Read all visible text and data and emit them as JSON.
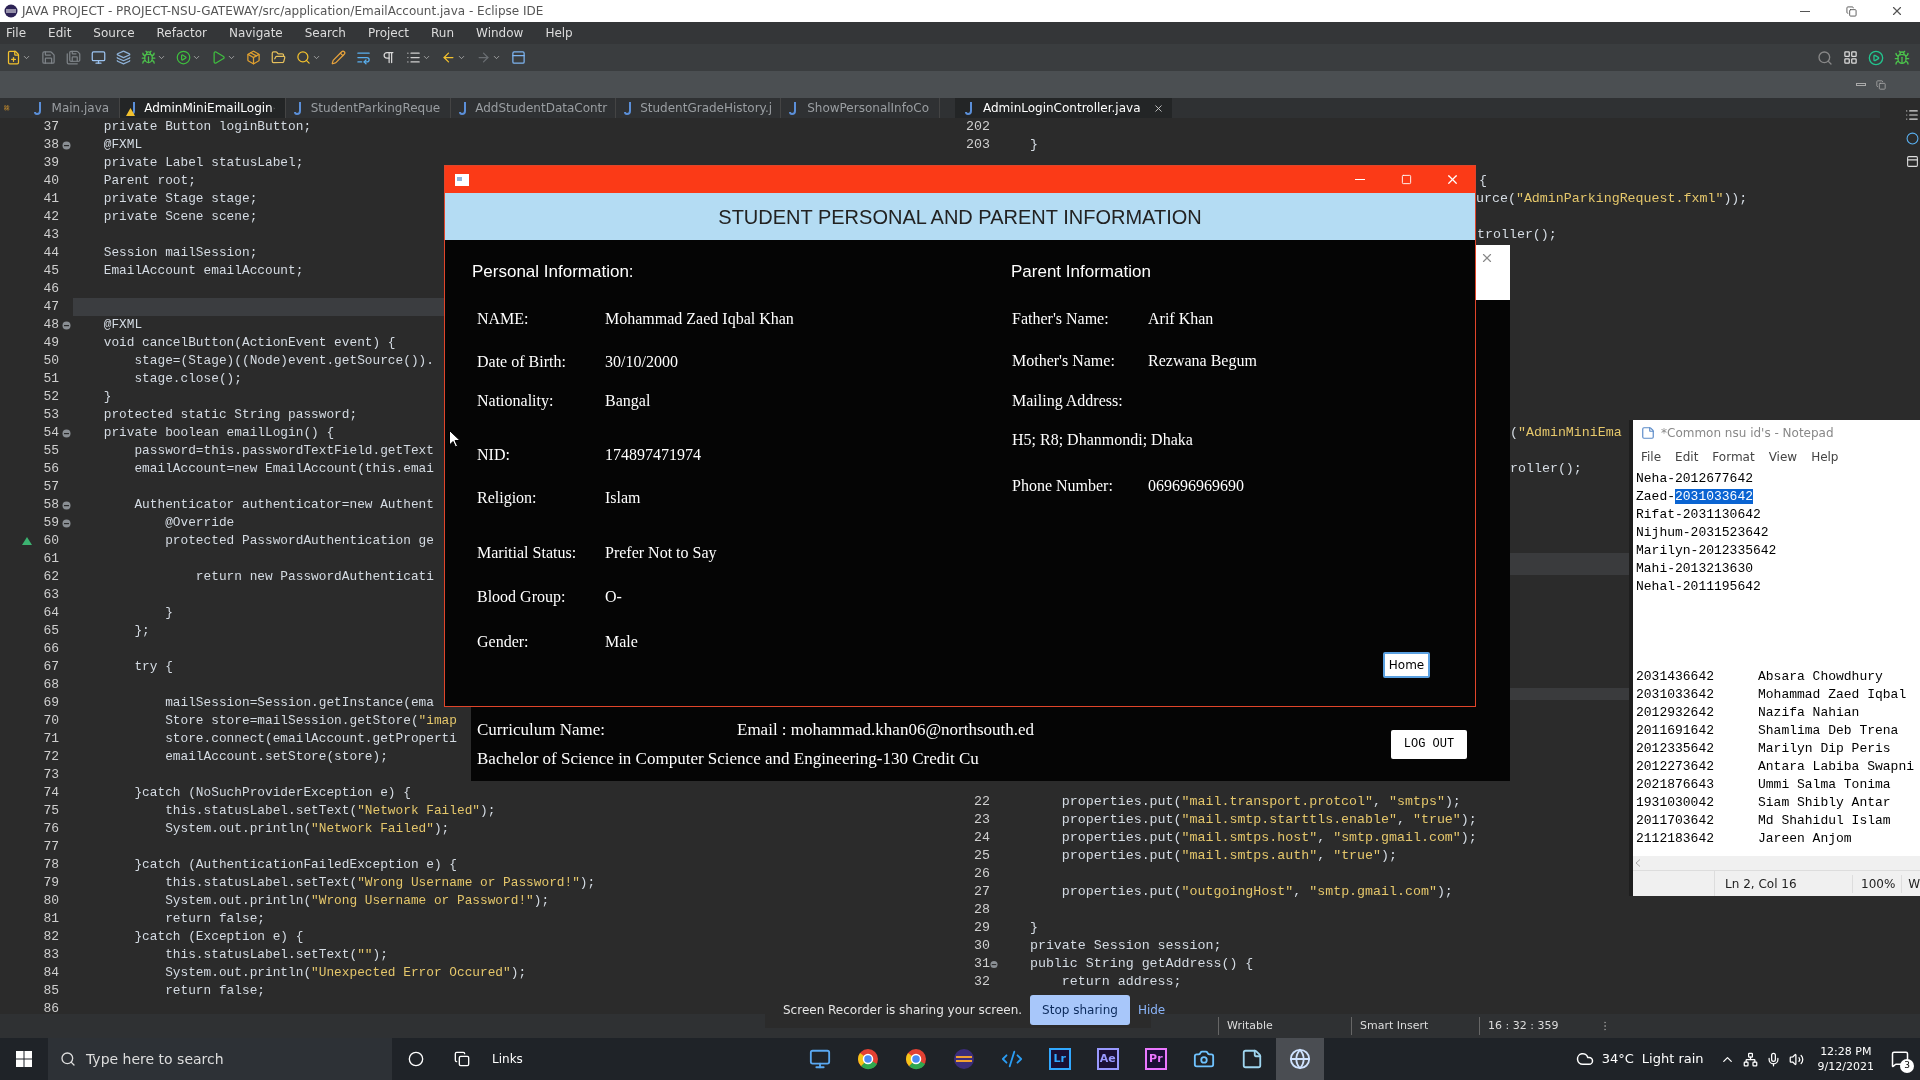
{
  "window": {
    "title": "JAVA PROJECT - PROJECT-NSU-GATEWAY/src/application/EmailAccount.java - Eclipse IDE"
  },
  "menu": [
    "File",
    "Edit",
    "Source",
    "Refactor",
    "Navigate",
    "Search",
    "Project",
    "Run",
    "Window",
    "Help"
  ],
  "left_tabs": [
    {
      "label": "Main.java",
      "selected": false,
      "warning": false
    },
    {
      "label": "AdminMiniEmailLogin",
      "selected": true,
      "warning": true
    },
    {
      "label": "StudentParkingReque",
      "selected": false,
      "warning": false
    },
    {
      "label": "AddStudentDataContr",
      "selected": false,
      "warning": false
    },
    {
      "label": "StudentGradeHistory.j",
      "selected": false,
      "warning": false
    },
    {
      "label": "ShowPersonalInfoCo",
      "selected": false,
      "warning": false
    }
  ],
  "left_editor": {
    "lines": [
      {
        "number": "37",
        "code": "    private Button loginButton;",
        "fold": false,
        "current": false,
        "override": false
      },
      {
        "number": "38",
        "code": "    @FXML",
        "fold": true,
        "current": false,
        "override": false
      },
      {
        "number": "39",
        "code": "    private Label statusLabel;",
        "fold": false,
        "current": false,
        "override": false
      },
      {
        "number": "40",
        "code": "    Parent root;",
        "fold": false,
        "current": false,
        "override": false
      },
      {
        "number": "41",
        "code": "    private Stage stage;",
        "fold": false,
        "current": false,
        "override": false
      },
      {
        "number": "42",
        "code": "    private Scene scene;",
        "fold": false,
        "current": false,
        "override": false
      },
      {
        "number": "43",
        "fold": false,
        "current": false,
        "override": false
      },
      {
        "number": "44",
        "code": "    Session mailSession;",
        "fold": false,
        "current": false,
        "override": false
      },
      {
        "number": "45",
        "code": "    EmailAccount emailAccount;",
        "fold": false,
        "current": false,
        "override": false
      },
      {
        "number": "46",
        "fold": false,
        "current": false,
        "override": false
      },
      {
        "number": "47",
        "fold": false,
        "current": true,
        "override": false
      },
      {
        "number": "48",
        "code": "    @FXML",
        "fold": true,
        "current": false,
        "override": false
      },
      {
        "number": "49",
        "code": "    void cancelButton(ActionEvent event) {",
        "fold": false,
        "current": false,
        "override": false
      },
      {
        "number": "50",
        "code": "        stage=(Stage)((Node)event.getSource()).",
        "fold": false,
        "current": false,
        "override": false
      },
      {
        "number": "51",
        "code": "        stage.close();",
        "fold": false,
        "current": false,
        "override": false
      },
      {
        "number": "52",
        "code": "    }",
        "fold": false,
        "current": false,
        "override": false
      },
      {
        "number": "53",
        "code": "    protected static String password;",
        "fold": false,
        "current": false,
        "override": false
      },
      {
        "number": "54",
        "code": "    private boolean emailLogin() {",
        "fold": true,
        "current": false,
        "override": false
      },
      {
        "number": "55",
        "code": "        password=this.passwordTextField.getText",
        "fold": false,
        "current": false,
        "override": false
      },
      {
        "number": "56",
        "code": "        emailAccount=new EmailAccount(this.emai",
        "fold": false,
        "current": false,
        "override": false
      },
      {
        "number": "57",
        "fold": false,
        "current": false,
        "override": false
      },
      {
        "number": "58",
        "code": "        Authenticator authenticator=new Authent",
        "fold": true,
        "current": false,
        "override": false
      },
      {
        "number": "59",
        "code": "            @Override",
        "fold": true,
        "current": false,
        "override": false
      },
      {
        "number": "60",
        "code": "            protected PasswordAuthentication ge",
        "fold": false,
        "current": false,
        "override": true
      },
      {
        "number": "61",
        "fold": false,
        "current": false,
        "override": false
      },
      {
        "number": "62",
        "code": "                return new PasswordAuthenticati",
        "fold": false,
        "current": false,
        "override": false
      },
      {
        "number": "63",
        "fold": false,
        "current": false,
        "override": false
      },
      {
        "number": "64",
        "code": "            }",
        "fold": false,
        "current": false,
        "override": false
      },
      {
        "number": "65",
        "code": "        };",
        "fold": false,
        "current": false,
        "override": false
      },
      {
        "number": "66",
        "fold": false,
        "current": false,
        "override": false
      },
      {
        "number": "67",
        "code": "        try {",
        "fold": false,
        "current": false,
        "override": false
      },
      {
        "number": "68",
        "fold": false,
        "current": false,
        "override": false
      },
      {
        "number": "69",
        "code": "            mailSession=Session.getInstance(ema",
        "fold": false,
        "current": false,
        "override": false
      },
      {
        "number": "70",
        "code": "            Store store=mailSession.getStore(\"imap",
        "fold": false,
        "current": false,
        "override": false
      },
      {
        "number": "71",
        "code": "            store.connect(emailAccount.getProperti",
        "fold": false,
        "current": false,
        "override": false
      },
      {
        "number": "72",
        "code": "            emailAccount.setStore(store);",
        "fold": false,
        "current": false,
        "override": false
      },
      {
        "number": "73",
        "fold": false,
        "current": false,
        "override": false
      },
      {
        "number": "74",
        "code": "        }catch (NoSuchProviderException e) {",
        "fold": false,
        "current": false,
        "override": false
      },
      {
        "number": "75",
        "code": "            this.statusLabel.setText(\"Network Failed\");",
        "fold": false,
        "current": false,
        "override": false
      },
      {
        "number": "76",
        "code": "            System.out.println(\"Network Failed\");",
        "fold": false,
        "current": false,
        "override": false
      },
      {
        "number": "77",
        "fold": false,
        "current": false,
        "override": false
      },
      {
        "number": "78",
        "code": "        }catch (AuthenticationFailedException e) {",
        "fold": false,
        "current": false,
        "override": false
      },
      {
        "number": "79",
        "code": "            this.statusLabel.setText(\"Wrong Username or Password!\");",
        "fold": false,
        "current": false,
        "override": false
      },
      {
        "number": "80",
        "code": "            System.out.println(\"Wrong Username or Password!\");",
        "fold": false,
        "current": false,
        "override": false
      },
      {
        "number": "81",
        "code": "            return false;",
        "fold": false,
        "current": false,
        "override": false
      },
      {
        "number": "82",
        "code": "        }catch (Exception e) {",
        "fold": false,
        "current": false,
        "override": false
      },
      {
        "number": "83",
        "code": "            this.statusLabel.setText(\"\");",
        "fold": false,
        "current": false,
        "override": false
      },
      {
        "number": "84",
        "code": "            System.out.println(\"Unexpected Error Occured\");",
        "fold": false,
        "current": false,
        "override": false
      },
      {
        "number": "85",
        "code": "            return false;",
        "fold": false,
        "current": false,
        "override": false
      },
      {
        "number": "86",
        "fold": false,
        "current": false,
        "override": false
      }
    ]
  },
  "right_editor": {
    "tabs": [
      {
        "label": "AdminLoginController.java",
        "selected": true
      }
    ],
    "top_lines": [
      {
        "kind": "line",
        "number": "202"
      },
      {
        "kind": "line",
        "number": "203",
        "code": "    }"
      },
      {
        "kind": "fragment",
        "code": "{"
      },
      {
        "kind": "fragment",
        "code": "urce(\"AdminParkingRequest.fxml\"));"
      },
      {
        "kind": "fragment",
        "code": "troller();"
      },
      {
        "kind": "fragment",
        "code": "(\"AdminMiniEma"
      },
      {
        "kind": "fragment",
        "code": "roller();"
      }
    ],
    "lower_lines": [
      {
        "number": "22",
        "code": "        properties.put(\"mail.transport.protcol\", \"smtps\");",
        "fold": false
      },
      {
        "number": "23",
        "code": "        properties.put(\"mail.smtp.starttls.enable\", \"true\");",
        "fold": false
      },
      {
        "number": "24",
        "code": "        properties.put(\"mail.smtps.host\", \"smtp.gmail.com\");",
        "fold": false
      },
      {
        "number": "25",
        "code": "        properties.put(\"mail.smtps.auth\", \"true\");",
        "fold": false
      },
      {
        "number": "26",
        "fold": false
      },
      {
        "number": "27",
        "code": "        properties.put(\"outgoingHost\", \"smtp.gmail.com\");",
        "fold": false
      },
      {
        "number": "28",
        "fold": false
      },
      {
        "number": "29",
        "code": "    }",
        "fold": false
      },
      {
        "number": "30",
        "code": "    private Session session;",
        "fold": false
      },
      {
        "number": "31",
        "code": "    public String getAddress() {",
        "fold": true
      },
      {
        "number": "32",
        "code": "        return address;",
        "fold": false
      }
    ]
  },
  "back_window": {
    "curriculum_label": "Curriculum Name:",
    "email": "Email : mohammad.khan06@northsouth.ed",
    "curriculum": "Bachelor of Science in Computer Science and Engineering-130 Credit Cu",
    "logout": "LOG OUT"
  },
  "dialog": {
    "heading": "STUDENT PERSONAL AND PARENT INFORMATION",
    "personal": {
      "title": "Personal Information:",
      "fields": [
        {
          "label": "NAME:",
          "value": "Mohammad Zaed Iqbal Khan"
        },
        {
          "label": "Date of Birth:",
          "value": "30/10/2000"
        },
        {
          "label": "Nationality:",
          "value": "Bangal"
        },
        {
          "label": "NID:",
          "value": "174897471974"
        },
        {
          "label": "Religion:",
          "value": "Islam"
        },
        {
          "label": "Maritial Status:",
          "value": "Prefer Not to Say"
        },
        {
          "label": "Blood Group:",
          "value": "O-"
        },
        {
          "label": "Gender:",
          "value": "Male"
        }
      ]
    },
    "parent": {
      "title": "Parent Information",
      "fields": [
        {
          "kind": "inline",
          "label": "Father's Name:",
          "value": "Arif Khan"
        },
        {
          "kind": "inline",
          "label": "Mother's Name:",
          "value": "Rezwana Begum"
        },
        {
          "kind": "stacked",
          "label": "Mailing Address:",
          "value": "H5; R8; Dhanmondi; Dhaka"
        },
        {
          "kind": "inline",
          "label": "Phone Number:",
          "value": "069696969690"
        }
      ]
    },
    "home_button": "Home"
  },
  "notepad": {
    "title": "*Common nsu id's - Notepad",
    "menu": [
      "File",
      "Edit",
      "Format",
      "View",
      "Help"
    ],
    "lines": [
      {
        "text": "Neha-2012677642"
      },
      {
        "text": "Zaed-",
        "selection": "2031033642"
      },
      {
        "text": "Rifat-2031130642"
      },
      {
        "text": "Nijhum-2031523642"
      },
      {
        "text": "Marilyn-2012335642"
      },
      {
        "text": "Mahi-2013213630"
      },
      {
        "text": "Nehal-2011195642"
      }
    ],
    "table": [
      {
        "id": "2031436642",
        "name": "Absara Chowdhury"
      },
      {
        "id": "2031033642",
        "name": "Mohammad Zaed Iqbal"
      },
      {
        "id": "2012932642",
        "name": "Nazifa Nahian"
      },
      {
        "id": "2011691642",
        "name": "Shamlima Deb Trena"
      },
      {
        "id": "2012335642",
        "name": "Marilyn Dip Peris"
      },
      {
        "id": "2012273642",
        "name": "Antara Labiba Swapni"
      },
      {
        "id": "2021876643",
        "name": "Ummi Salma Tonima"
      },
      {
        "id": "1931030042",
        "name": "Siam Shibly Antar"
      },
      {
        "id": "2011703642",
        "name": "Md Shahidul Islam"
      },
      {
        "id": "2112183642",
        "name": "Jareen Anjom"
      }
    ],
    "status": {
      "position": "Ln 2, Col 16",
      "zoom": "100%",
      "encoding": "W"
    }
  },
  "recorder": {
    "message": "Screen Recorder is sharing your screen.",
    "stop": "Stop sharing",
    "hide": "Hide"
  },
  "status_bar": {
    "mode": "Writable",
    "insert": "Smart Insert",
    "position": "16 : 32 : 359"
  },
  "taskbar": {
    "search_placeholder": "Type here to search",
    "toolbar_label": "Links",
    "apps": [
      {
        "kind": "desktop",
        "selected": false
      },
      {
        "kind": "chrome",
        "selected": false
      },
      {
        "kind": "chrome",
        "selected": false
      },
      {
        "kind": "bar",
        "selected": false
      },
      {
        "kind": "vscode",
        "selected": false
      },
      {
        "kind": "tile",
        "label": "Lr",
        "color": "#31a8ff",
        "selected": false
      },
      {
        "kind": "tile",
        "label": "Ae",
        "color": "#9999ff",
        "selected": false
      },
      {
        "kind": "tile",
        "label": "Pr",
        "color": "#ea77ff",
        "selected": false
      },
      {
        "kind": "camera",
        "selected": false
      },
      {
        "kind": "notes",
        "selected": false
      },
      {
        "kind": "globe",
        "selected": true
      }
    ],
    "temperature": "34°C",
    "weather": "Light rain",
    "time": "12:28 PM",
    "date": "9/12/2021",
    "notifications": "3"
  }
}
